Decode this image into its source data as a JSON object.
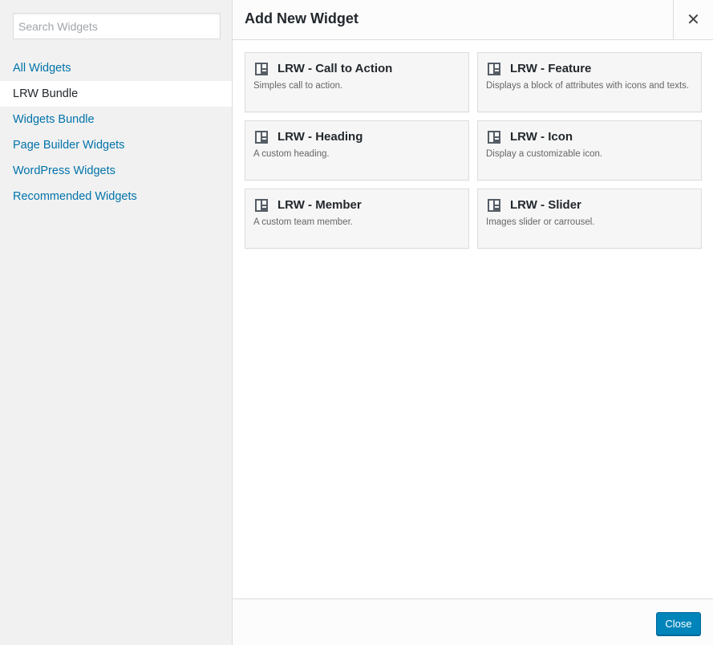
{
  "sidebar": {
    "search_placeholder": "Search Widgets",
    "items": [
      {
        "label": "All Widgets",
        "active": false
      },
      {
        "label": "LRW Bundle",
        "active": true
      },
      {
        "label": "Widgets Bundle",
        "active": false
      },
      {
        "label": "Page Builder Widgets",
        "active": false
      },
      {
        "label": "WordPress Widgets",
        "active": false
      },
      {
        "label": "Recommended Widgets",
        "active": false
      }
    ]
  },
  "header": {
    "title": "Add New Widget",
    "close_icon": "close-icon"
  },
  "widgets": [
    {
      "title": "LRW - Call to Action",
      "description": "Simples call to action.",
      "icon": "widget-layout-icon"
    },
    {
      "title": "LRW - Feature",
      "description": "Displays a block of attributes with icons and texts.",
      "icon": "widget-layout-icon"
    },
    {
      "title": "LRW - Heading",
      "description": "A custom heading.",
      "icon": "widget-layout-icon"
    },
    {
      "title": "LRW - Icon",
      "description": "Display a customizable icon.",
      "icon": "widget-layout-icon"
    },
    {
      "title": "LRW - Member",
      "description": "A custom team member.",
      "icon": "widget-layout-icon"
    },
    {
      "title": "LRW - Slider",
      "description": "Images slider or carrousel.",
      "icon": "widget-layout-icon"
    }
  ],
  "footer": {
    "close_label": "Close"
  },
  "colors": {
    "link": "#0073aa",
    "primary_button": "#0085ba",
    "sidebar_bg": "#f1f1f1"
  }
}
